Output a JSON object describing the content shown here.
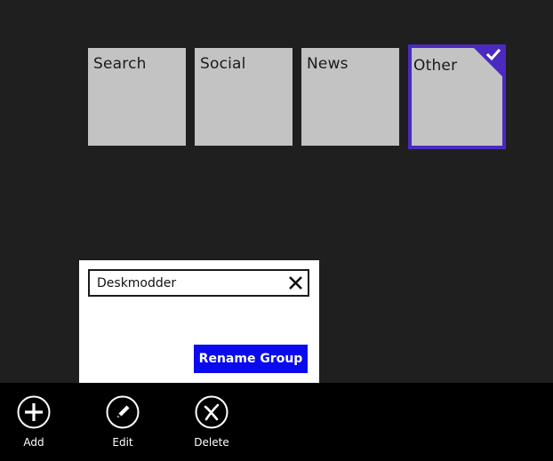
{
  "tiles": [
    {
      "label": "Search",
      "selected": false
    },
    {
      "label": "Social",
      "selected": false
    },
    {
      "label": "News",
      "selected": false
    },
    {
      "label": "Other",
      "selected": true
    }
  ],
  "rename": {
    "input_value": "Deskmodder",
    "button_label": "Rename Group",
    "clear_icon": "close-icon"
  },
  "app_bar": {
    "add_label": "Add",
    "edit_label": "Edit",
    "delete_label": "Delete"
  },
  "colors": {
    "background": "#1f1f1f",
    "tile": "#c3c3c3",
    "selection": "#4a2abf",
    "button": "#0a0aef",
    "app_bar": "#000000"
  }
}
